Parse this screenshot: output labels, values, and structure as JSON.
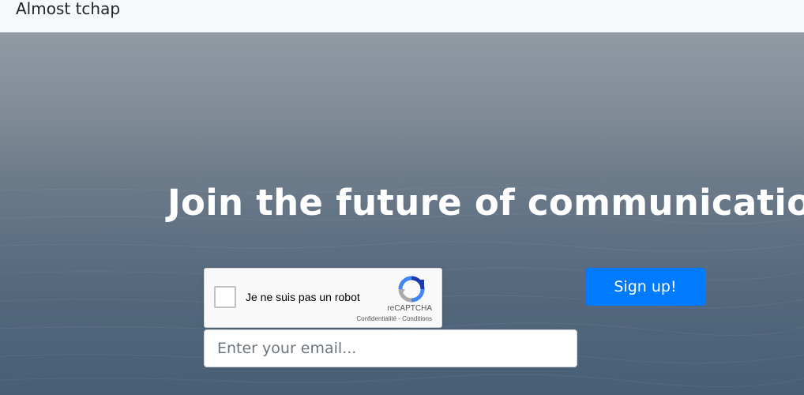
{
  "navbar": {
    "brand": "Almost tchap"
  },
  "hero": {
    "headline": "Join the future of communication!"
  },
  "captcha": {
    "label": "Je ne suis pas un robot",
    "brand": "reCAPTCHA",
    "privacy_link": "Confidentialité",
    "separator": " - ",
    "terms_link": "Conditions"
  },
  "signup": {
    "button_label": "Sign up!",
    "email_placeholder": "Enter your email...",
    "email_value": ""
  },
  "colors": {
    "navbar_bg": "#f8f9fa",
    "primary_button": "#007bff",
    "headline": "#ffffff"
  }
}
